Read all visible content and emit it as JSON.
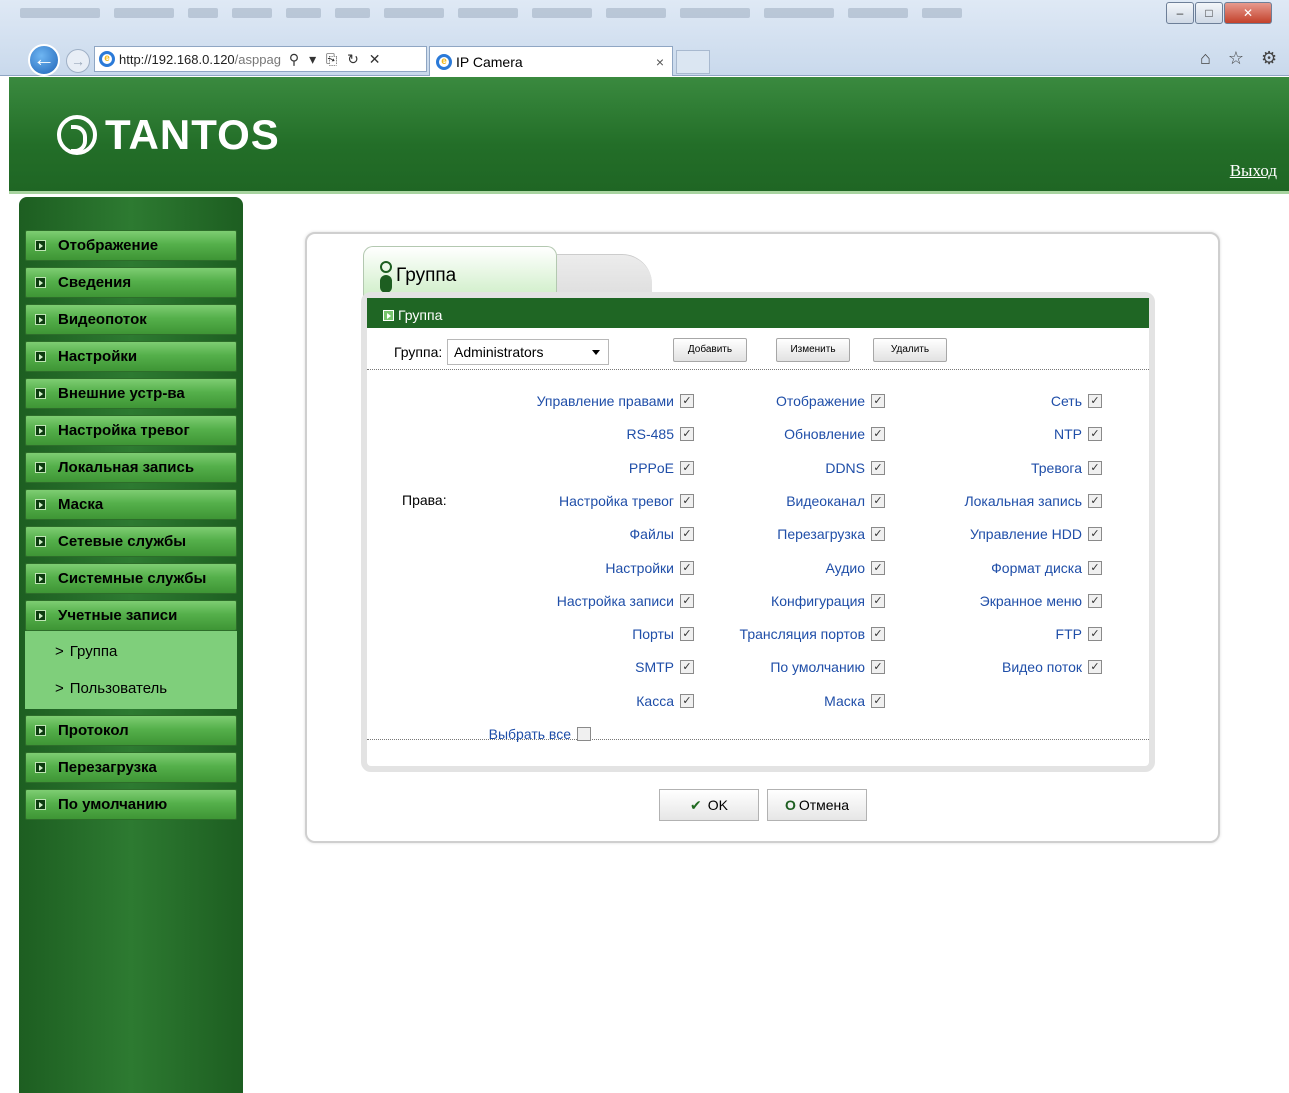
{
  "browser": {
    "url": "http://192.168.0.120/asppag",
    "url_host": "http://192.168.0.120",
    "url_tail": "/asppag",
    "tab_title": "IP Camera",
    "tab_close": "×",
    "address_icons": "⚲ ▾ ⎘ ↻ ✕",
    "chrome_icons": "⌂ ☆ ⚙",
    "window_min": "–",
    "window_max": "□",
    "window_close": "✕"
  },
  "header": {
    "logo": "TANTOS",
    "logout": "Выход"
  },
  "sidebar": {
    "items": [
      {
        "label": "Отображение"
      },
      {
        "label": "Сведения"
      },
      {
        "label": "Видеопоток"
      },
      {
        "label": "Настройки"
      },
      {
        "label": "Внешние устр-ва"
      },
      {
        "label": "Настройка тревог"
      },
      {
        "label": "Локальная запись"
      },
      {
        "label": "Маска"
      },
      {
        "label": "Сетевые службы"
      },
      {
        "label": "Системные службы"
      },
      {
        "label": "Учетные записи"
      },
      {
        "label": "Протокол"
      },
      {
        "label": "Перезагрузка"
      },
      {
        "label": "По умолчанию"
      }
    ],
    "submenu": [
      {
        "label": "Группа",
        "chev": ">"
      },
      {
        "label": "Пользователь",
        "chev": ">"
      }
    ]
  },
  "panel": {
    "tab_label": "Группа",
    "section_title": "Группа",
    "group_label": "Группа:",
    "group_value": "Administrators",
    "buttons": {
      "add": "Добавить",
      "edit": "Изменить",
      "delete": "Удалить"
    },
    "rights_label": "Права:",
    "permissions": [
      {
        "label": "Управление правами",
        "checked": true
      },
      {
        "label": "Отображение",
        "checked": true
      },
      {
        "label": "Сеть",
        "checked": true
      },
      {
        "label": "RS-485",
        "checked": true
      },
      {
        "label": "Обновление",
        "checked": true
      },
      {
        "label": "NTP",
        "checked": true
      },
      {
        "label": "PPPoE",
        "checked": true
      },
      {
        "label": "DDNS",
        "checked": true
      },
      {
        "label": "Тревога",
        "checked": true
      },
      {
        "label": "Настройка тревог",
        "checked": true
      },
      {
        "label": "Видеоканал",
        "checked": true
      },
      {
        "label": "Локальная запись",
        "checked": true
      },
      {
        "label": "Файлы",
        "checked": true
      },
      {
        "label": "Перезагрузка",
        "checked": true
      },
      {
        "label": "Управление HDD",
        "checked": true
      },
      {
        "label": "Настройки",
        "checked": true
      },
      {
        "label": "Аудио",
        "checked": true
      },
      {
        "label": "Формат диска",
        "checked": true
      },
      {
        "label": "Настройка записи",
        "checked": true
      },
      {
        "label": "Конфигурация",
        "checked": true
      },
      {
        "label": "Экранное меню",
        "checked": true
      },
      {
        "label": "Порты",
        "checked": true
      },
      {
        "label": "Трансляция портов",
        "checked": true
      },
      {
        "label": "FTP",
        "checked": true
      },
      {
        "label": "SMTP",
        "checked": true
      },
      {
        "label": "По умолчанию",
        "checked": true
      },
      {
        "label": "Видео поток",
        "checked": true
      },
      {
        "label": "Касса",
        "checked": true
      },
      {
        "label": "Маска",
        "checked": true
      }
    ],
    "select_all": {
      "label": "Выбрать все",
      "checked": false
    },
    "checkmark": "✓",
    "ok": "OK",
    "ok_icon": "✔",
    "cancel": "Отмена",
    "cancel_icon": "O"
  },
  "colors": {
    "header_green": "#236e28",
    "menu_green": "#55b04b",
    "link_blue": "#1f4ea8"
  }
}
